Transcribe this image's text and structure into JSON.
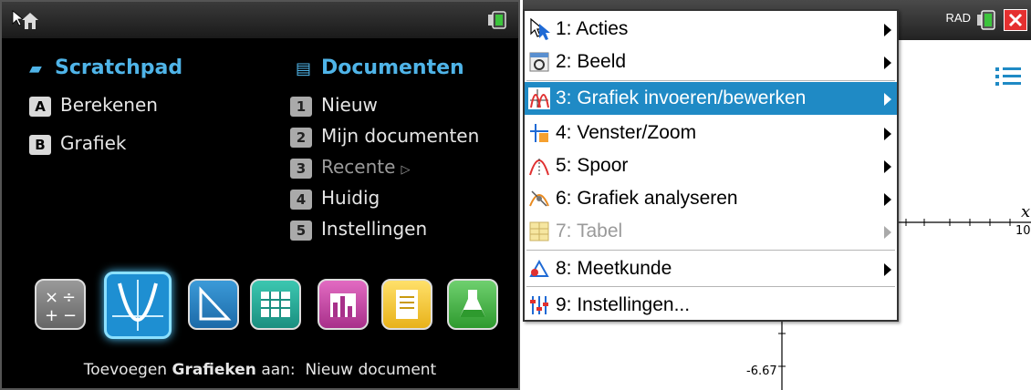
{
  "home": {
    "scratchpad": {
      "title": "Scratchpad",
      "items": [
        {
          "key": "A",
          "label": "Berekenen"
        },
        {
          "key": "B",
          "label": "Grafiek"
        }
      ]
    },
    "documents": {
      "title": "Documenten",
      "items": [
        {
          "key": "1",
          "label": "Nieuw"
        },
        {
          "key": "2",
          "label": "Mijn documenten"
        },
        {
          "key": "3",
          "label": "Recente"
        },
        {
          "key": "4",
          "label": "Huidig"
        },
        {
          "key": "5",
          "label": "Instellingen"
        }
      ]
    },
    "apps": [
      "calculator-app-icon",
      "graphs-app-icon",
      "geometry-app-icon",
      "lists-spreadsheet-app-icon",
      "data-statistics-app-icon",
      "notes-app-icon",
      "vernier-dataquest-app-icon"
    ],
    "footer": {
      "prefix": "Toevoegen",
      "app": "Grafieken",
      "middle": "aan:",
      "target": "Nieuw document"
    }
  },
  "graph": {
    "status": "RAD",
    "axis": {
      "x_label": "x",
      "x_tick": "10",
      "y_tick": "-6.67"
    }
  },
  "menu": {
    "items": [
      {
        "label": "1: Acties",
        "icon": "pointer-icon",
        "submenu": true
      },
      {
        "label": "2: Beeld",
        "icon": "view-icon",
        "submenu": true
      },
      {
        "label": "3: Grafiek invoeren/bewerken",
        "icon": "graph-entry-icon",
        "submenu": true,
        "highlighted": true
      },
      {
        "label": "4: Venster/Zoom",
        "icon": "window-zoom-icon",
        "submenu": true
      },
      {
        "label": "5: Spoor",
        "icon": "trace-icon",
        "submenu": true
      },
      {
        "label": "6: Grafiek analyseren",
        "icon": "analyze-icon",
        "submenu": true
      },
      {
        "label": "7: Tabel",
        "icon": "table-icon",
        "submenu": true,
        "disabled": true
      },
      {
        "label": "8: Meetkunde",
        "icon": "geometry-icon",
        "submenu": true
      },
      {
        "label": "9: Instellingen...",
        "icon": "settings-icon",
        "submenu": false
      }
    ]
  },
  "colors": {
    "accent": "#4fb4e8",
    "highlight": "#1f8ac5",
    "battery": "#3cc43c",
    "close": "#e53030"
  }
}
